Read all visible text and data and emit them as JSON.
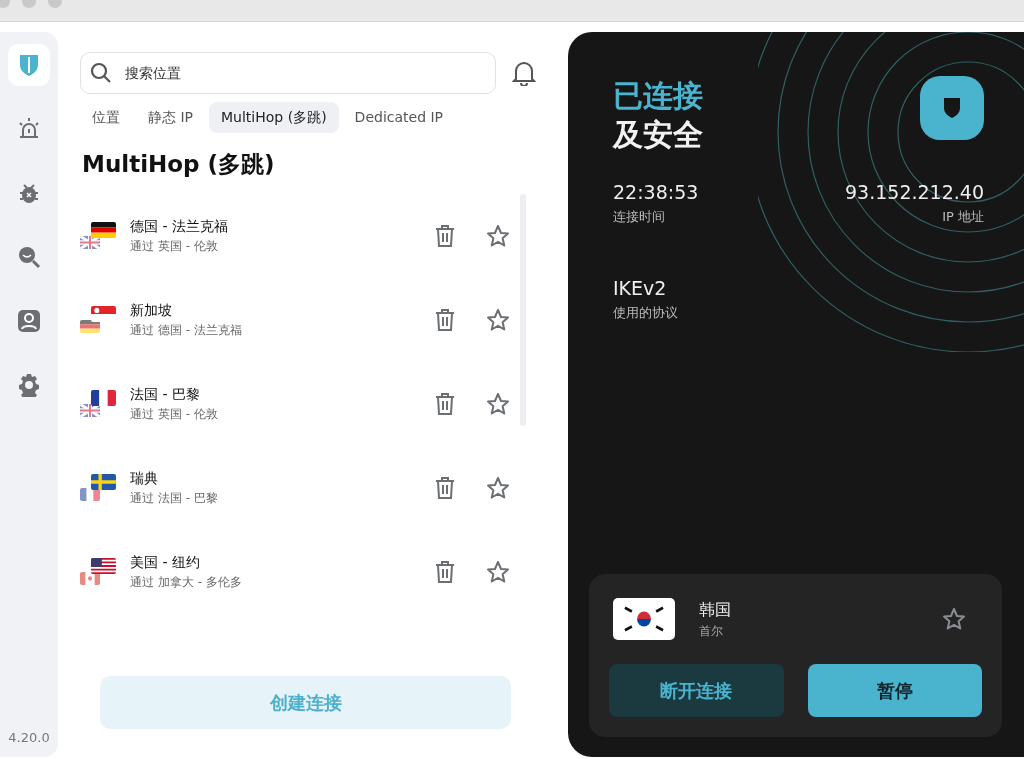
{
  "sidebar": {
    "items": [
      {
        "kind": "shield",
        "selected": true
      },
      {
        "kind": "alarm",
        "selected": false
      },
      {
        "kind": "bug",
        "selected": false
      },
      {
        "kind": "eye-search",
        "selected": false
      },
      {
        "kind": "user",
        "selected": false
      },
      {
        "kind": "gear",
        "selected": false
      }
    ],
    "version": "4.20.0"
  },
  "search": {
    "placeholder": "搜索位置"
  },
  "tabs": [
    {
      "label": "位置",
      "selected": false
    },
    {
      "label": "静态 IP",
      "selected": false
    },
    {
      "label": "MultiHop (多跳)",
      "selected": true
    },
    {
      "label": "Dedicated IP",
      "selected": false
    }
  ],
  "list": {
    "title": "MultiHop (多跳)",
    "items": [
      {
        "name": "德国 - 法兰克福",
        "via": "通过 英国 - 伦敦",
        "flag": {
          "kind": "de"
        },
        "via_flag": {
          "kind": "gb"
        }
      },
      {
        "name": "新加坡",
        "via": "通过 德国 - 法兰克福",
        "flag": {
          "kind": "sg"
        },
        "via_flag": {
          "kind": "de"
        }
      },
      {
        "name": "法国 - 巴黎",
        "via": "通过 英国 - 伦敦",
        "flag": {
          "kind": "fr"
        },
        "via_flag": {
          "kind": "gb"
        }
      },
      {
        "name": "瑞典",
        "via": "通过 法国 - 巴黎",
        "flag": {
          "kind": "se"
        },
        "via_flag": {
          "kind": "fr"
        }
      },
      {
        "name": "美国 - 纽约",
        "via": "通过 加拿大 - 多伦多",
        "flag": {
          "kind": "us"
        },
        "via_flag": {
          "kind": "ca"
        }
      }
    ]
  },
  "create_button": "创建连接",
  "status": {
    "line1": "已连接",
    "line2": "及安全",
    "stats": [
      {
        "value": "22:38:53",
        "label": "连接时间"
      },
      {
        "value": "93.152.212.40",
        "label": "IP 地址"
      }
    ],
    "protocol": {
      "value": "IKEv2",
      "label": "使用的协议"
    }
  },
  "current": {
    "country": "韩国",
    "city": "首尔",
    "flag": {
      "kind": "kr"
    },
    "favorite": false
  },
  "buttons": [
    {
      "label": "断开连接",
      "kind": "secondary"
    },
    {
      "label": "暂停",
      "kind": "primary"
    }
  ]
}
